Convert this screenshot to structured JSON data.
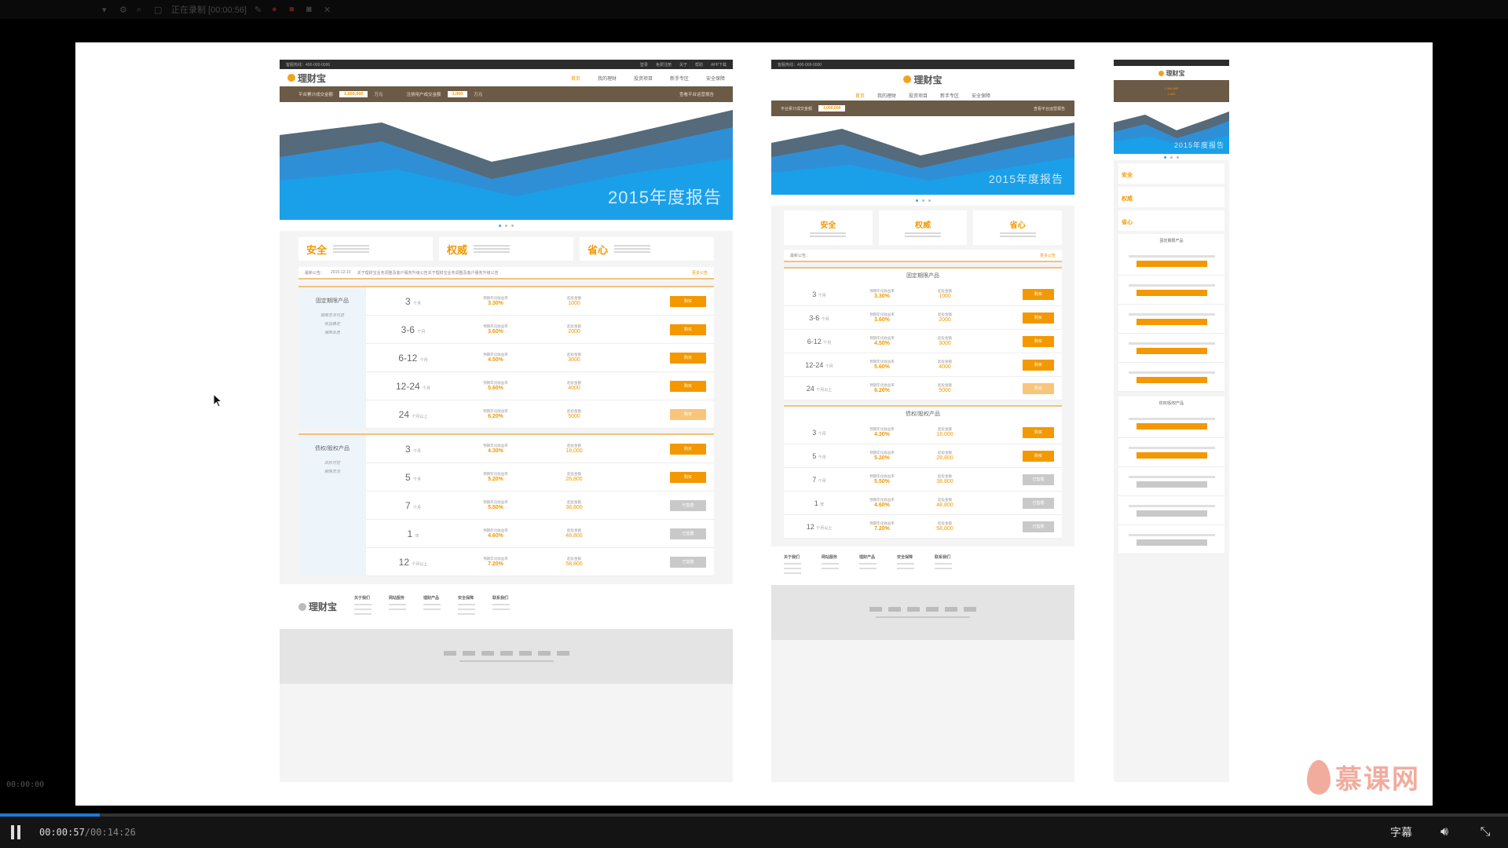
{
  "recorder": {
    "status_text": "正在录制 [00:00:56]"
  },
  "player": {
    "current_time": "00:00:57",
    "total_time": "/00:14:26",
    "subtitles_label": "字幕",
    "progress_fraction": 0.066,
    "overlay_timestamp": "00:00:00",
    "accent_color": "#1e7ad8"
  },
  "mockup": {
    "logo": "理财宝",
    "hotline": "客服热线：400-000-0000",
    "top_links": [
      "登录",
      "免费注册",
      "关于",
      "帮助",
      "APP下载"
    ],
    "nav": [
      "首页",
      "我的理财",
      "投资项目",
      "新手专区",
      "安全保障"
    ],
    "strip": {
      "label1": "平台累计成交金额",
      "value1": "1,000,000",
      "unit1": "万元",
      "label2": "注册用户成交金额",
      "value2": "1,000",
      "unit2": "万元",
      "right": "查看平台运营报告"
    },
    "banner_title": "2015年度报告",
    "features": [
      "安全",
      "权威",
      "省心"
    ],
    "notice": {
      "label": "最新公告：",
      "date": "2015-12-10",
      "text": "关于理财宝业务调整及客户服务升级公告关于理财宝业务调整及客户服务升级公告",
      "more": "更多公告"
    },
    "fixed": {
      "title": "固定期限产品",
      "side_notes": [
        "期限灵活可选",
        "收益稳定",
        "保障本息"
      ],
      "rows": [
        {
          "term": "3",
          "unit": "个月",
          "rate": "3.30%",
          "amount": "1000",
          "btn": "购买",
          "state": "on"
        },
        {
          "term": "3-6",
          "unit": "个月",
          "rate": "3.60%",
          "amount": "2000",
          "btn": "购买",
          "state": "on"
        },
        {
          "term": "6-12",
          "unit": "个月",
          "rate": "4.50%",
          "amount": "3000",
          "btn": "购买",
          "state": "on"
        },
        {
          "term": "12-24",
          "unit": "个月",
          "rate": "5.60%",
          "amount": "4000",
          "btn": "购买",
          "state": "on"
        },
        {
          "term": "24",
          "unit": "个月以上",
          "rate": "6.20%",
          "amount": "5000",
          "btn": "购买",
          "state": "light"
        }
      ]
    },
    "bond": {
      "title": "债权/股权产品",
      "side_notes": [
        "风险可控",
        "期限灵活"
      ],
      "rows": [
        {
          "term": "3",
          "unit": "个月",
          "rate": "4.30%",
          "amount": "18,000",
          "btn": "购买",
          "state": "on"
        },
        {
          "term": "5",
          "unit": "个月",
          "rate": "5.20%",
          "amount": "28,800",
          "btn": "购买",
          "state": "on"
        },
        {
          "term": "7",
          "unit": "个月",
          "rate": "5.50%",
          "amount": "38,800",
          "btn": "已售罄",
          "state": "grey"
        },
        {
          "term": "1",
          "unit": "年",
          "rate": "4.60%",
          "amount": "48,800",
          "btn": "已售罄",
          "state": "grey"
        },
        {
          "term": "12",
          "unit": "个月以上",
          "rate": "7.20%",
          "amount": "58,800",
          "btn": "已售罄",
          "state": "grey"
        }
      ]
    },
    "rate_label": "预期年化收益率",
    "amount_label": "起投金额",
    "footer_cols": [
      "关于我们",
      "网站服务",
      "理财产品",
      "安全保障",
      "联系我们"
    ]
  },
  "watermark": "慕课网"
}
